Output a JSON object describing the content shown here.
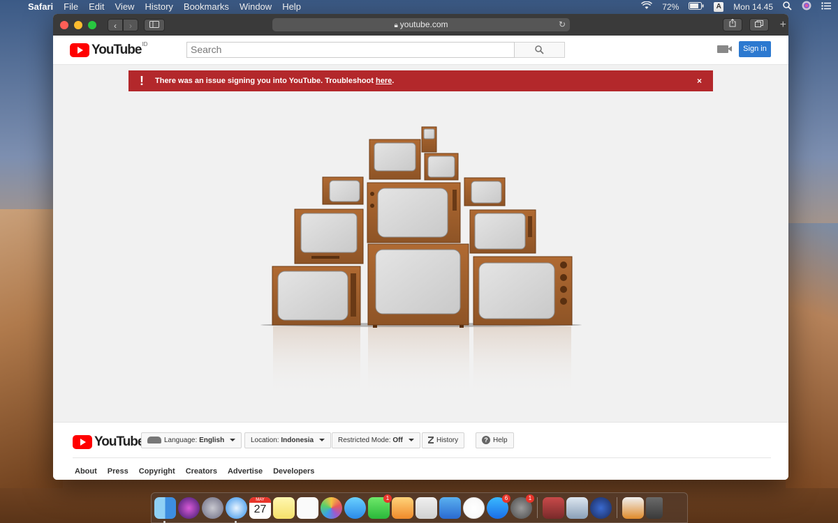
{
  "menubar": {
    "app_name": "Safari",
    "items": [
      "File",
      "Edit",
      "View",
      "History",
      "Bookmarks",
      "Window",
      "Help"
    ],
    "battery": "72%",
    "input_source": "A",
    "clock": "Mon 14.45"
  },
  "browser": {
    "url": "youtube.com"
  },
  "header": {
    "logo_text": "YouTube",
    "region": "ID",
    "search_placeholder": "Search",
    "signin_label": "Sign in"
  },
  "alert": {
    "message": "There was an issue signing you into YouTube. Troubleshoot",
    "link_text": "here",
    "suffix": ".",
    "close": "×",
    "icon": "!"
  },
  "footer": {
    "logo_text": "YouTube",
    "language_label": "Language:",
    "language_value": "English",
    "location_label": "Location:",
    "location_value": "Indonesia",
    "restricted_label": "Restricted Mode:",
    "restricted_value": "Off",
    "history_label": "History",
    "help_label": "Help",
    "links": [
      "About",
      "Press",
      "Copyright",
      "Creators",
      "Advertise",
      "Developers"
    ]
  },
  "dock": {
    "calendar_month": "MAY",
    "calendar_day": "27",
    "badges": {
      "facetime": "1",
      "appstore": "6",
      "prefs": "1"
    }
  },
  "colors": {
    "alert_bg": "#b3282b",
    "signin_bg": "#2c79d0",
    "youtube_red": "#ff0000",
    "tv_wood": "#a0612e"
  }
}
